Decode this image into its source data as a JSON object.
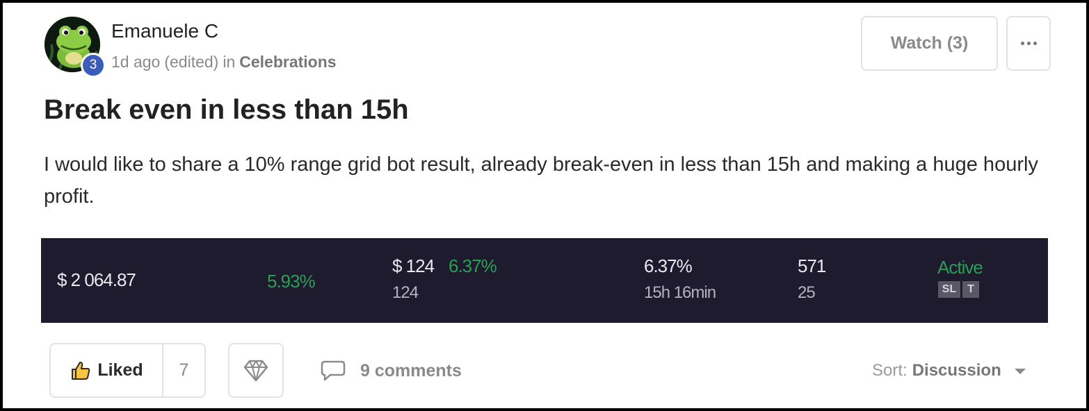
{
  "post": {
    "author": "Emanuele C",
    "author_level": "3",
    "time_ago": "1d ago",
    "edited": "(edited)",
    "in_label": "in",
    "category": "Celebrations",
    "title": "Break even in less than 15h",
    "body": "I would like to share a 10% range grid bot result, already break-even in less than 15h and making a huge hourly profit."
  },
  "header_actions": {
    "watch_label": "Watch (3)"
  },
  "bot_result": {
    "investment": "$ 2 064.87",
    "apr": "5.93%",
    "profit": "$ 124",
    "profit_pct": "6.37%",
    "profit_sub": "124",
    "return_pct": "6.37%",
    "runtime": "15h 16min",
    "transactions": "571",
    "transactions_sub": "25",
    "status": "Active",
    "tags": [
      "SL",
      "T"
    ],
    "colors": {
      "background": "#1e1b2e",
      "positive": "#2a9f55",
      "text": "#e9e9ef"
    }
  },
  "footer": {
    "like_label": "Liked",
    "like_count": "7",
    "comments_label": "9 comments",
    "sort_label": "Sort:",
    "sort_value": "Discussion"
  },
  "icons": {
    "like": "thumbs-up-icon",
    "gem": "gem-icon",
    "comment": "comment-bubble-icon",
    "more": "more-dots-icon",
    "sort": "chevron-down-icon"
  }
}
